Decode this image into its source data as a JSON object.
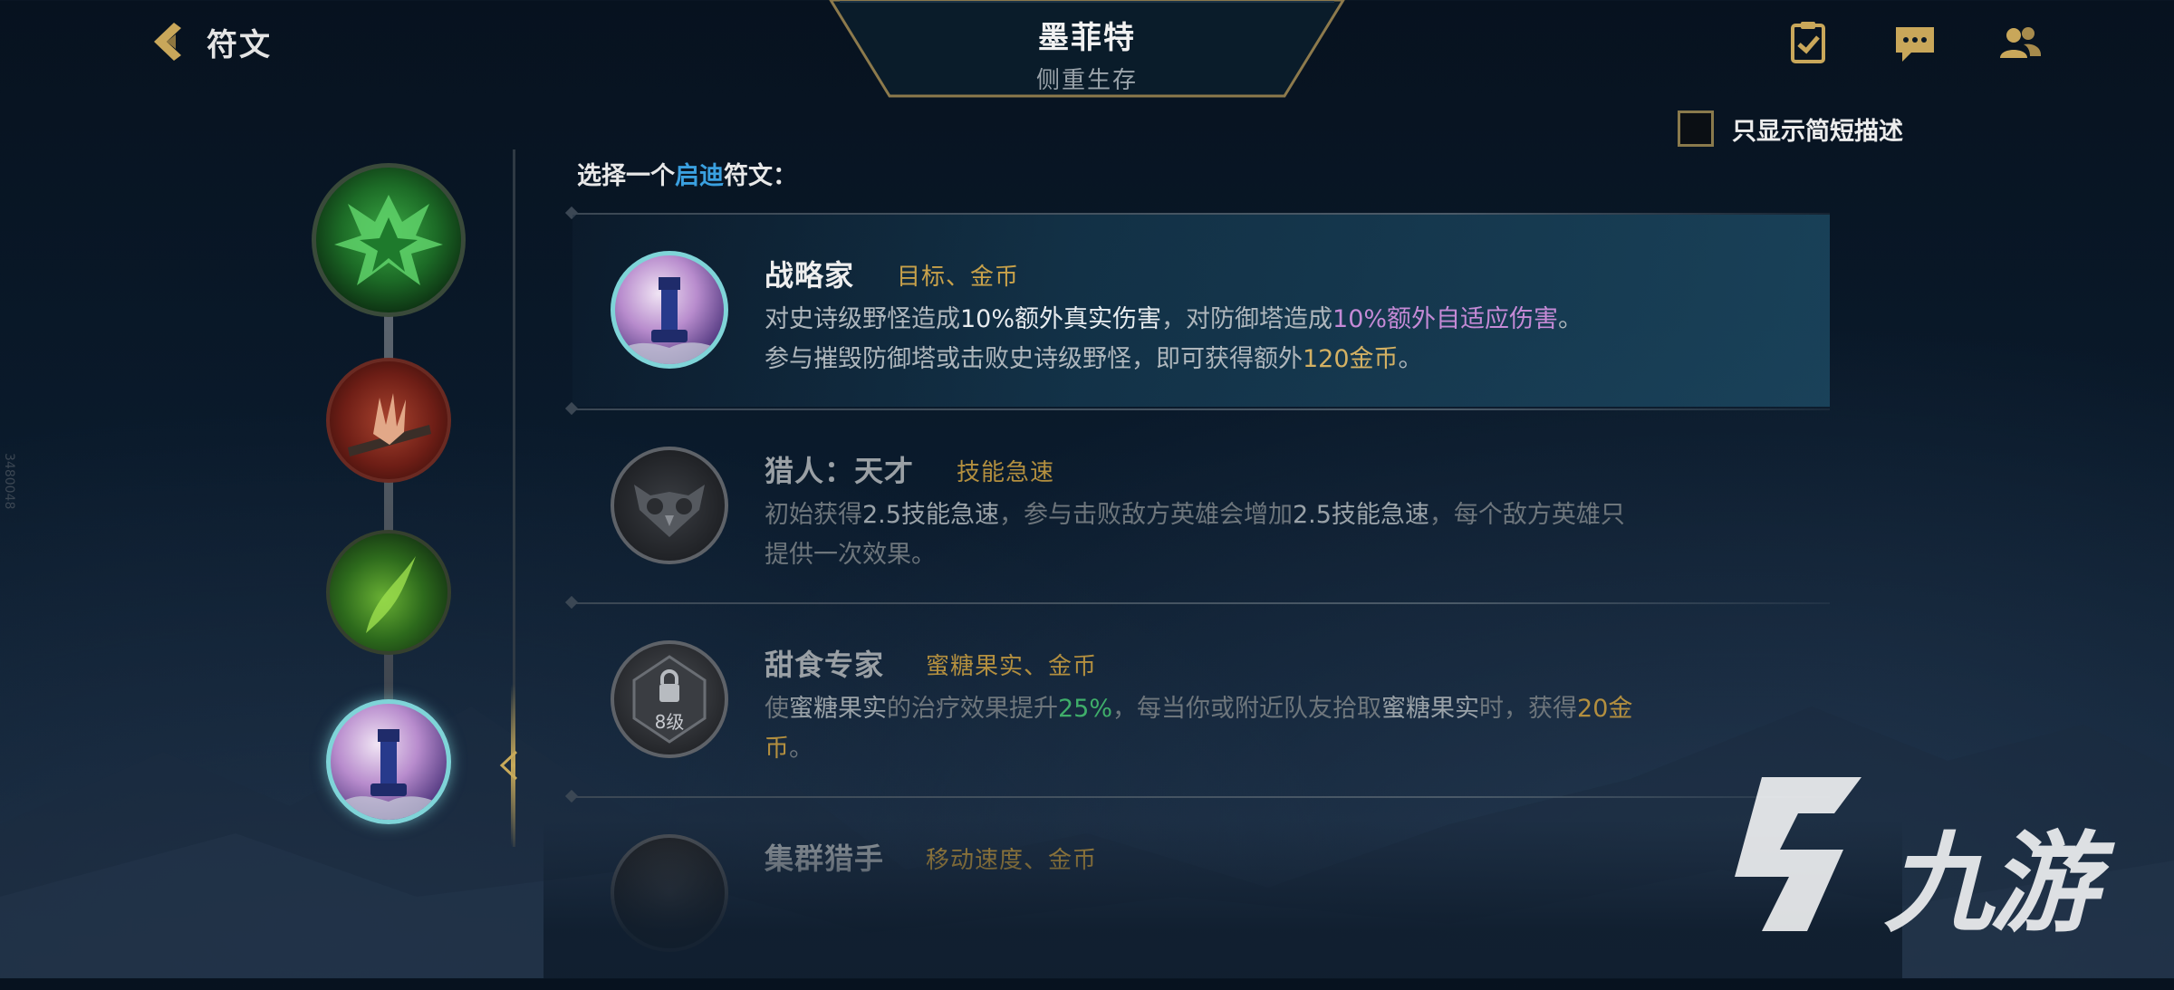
{
  "header": {
    "back_label": "符文",
    "champion_name": "墨菲特",
    "champion_subtitle": "侧重生存"
  },
  "top_icons": [
    "checklist-icon",
    "chat-icon",
    "friends-icon"
  ],
  "options": {
    "short_desc_label": "只显示简短描述",
    "short_desc_checked": false
  },
  "side_code": "3480048",
  "prompt": {
    "before": "选择一个",
    "highlight": "启迪",
    "after": "符文："
  },
  "rune_path": [
    "inspiration-keystone",
    "inspiration-minor-1",
    "inspiration-minor-2",
    "strategist-rune"
  ],
  "runes": [
    {
      "name": "战略家",
      "tags": "目标、金币",
      "selected": true,
      "desc_line1": {
        "p1": "对史诗级野怪造成",
        "v1": "10%额外真实伤害",
        "p2": "，对防御塔造成",
        "v2": "10%额外自适应伤害",
        "p3": "。"
      },
      "desc_line2": {
        "p1": "参与摧毁防御塔或击败史诗级野怪，即可获得额外",
        "v1": "120金币",
        "p2": "。"
      }
    },
    {
      "name": "猎人：天才",
      "tags": "技能急速",
      "selected": false,
      "desc": {
        "p1": "初始获得",
        "v1": "2.5技能急速",
        "p2": "，参与击败敌方英雄会增加",
        "v2": "2.5技能急速",
        "p3": "，每个敌方英雄只提供一次效果。"
      }
    },
    {
      "name": "甜食专家",
      "tags": "蜜糖果实、金币",
      "selected": false,
      "lock_level": "8级",
      "desc": {
        "p1": "使",
        "v1": "蜜糖果实",
        "p2": "的治疗效果提升",
        "v2": "25%",
        "p3": "，每当你或附近队友拾取",
        "v3": "蜜糖果实",
        "p4": "时，获得",
        "v4": "20金币",
        "p5": "。"
      }
    },
    {
      "name": "集群猎手",
      "tags": "移动速度、金币",
      "selected": false
    }
  ],
  "watermark": {
    "text": "九游"
  },
  "colors": {
    "accent_gold": "#c9a24a",
    "accent_blue": "#3aa0e0",
    "damage_purple": "#c58ad6",
    "heal_green": "#3fae6a"
  }
}
